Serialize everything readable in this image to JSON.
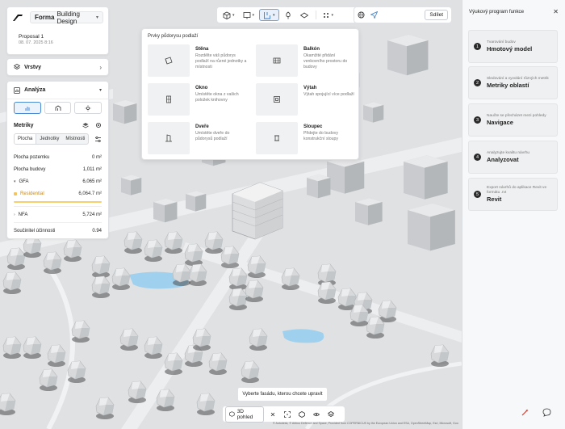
{
  "brand": {
    "name_bold": "Forma",
    "name_rest": "Building Design"
  },
  "proposal": {
    "name": "Proposal 1",
    "date": "08. 07. 2025 8:16"
  },
  "layers": {
    "label": "Vrstvy"
  },
  "analysis": {
    "label": "Analýza",
    "metrics_label": "Metriky",
    "tabs": [
      "Plocha",
      "Jednotky",
      "Místnosti"
    ],
    "rows": {
      "plot_area": {
        "label": "Plocha pozemku",
        "value": "0 m²"
      },
      "building_area": {
        "label": "Plocha budovy",
        "value": "1,011 m²"
      },
      "gfa": {
        "label": "GFA",
        "value": "6,065 m²"
      },
      "residential": {
        "label": "Residential",
        "value": "6,064.7 m²"
      },
      "nfa": {
        "label": "NFA",
        "value": "5,724 m²"
      },
      "efficiency": {
        "label": "Součinitel účinnosti",
        "value": "0.94"
      }
    }
  },
  "colors": {
    "accent": "#4a8bd4",
    "residential": "#f3c45b"
  },
  "toolbar": {
    "share_label": "Sdílet"
  },
  "panel": {
    "title": "Prvky půdorysu podlaží",
    "items": [
      {
        "title": "Stěna",
        "desc": "Rozdělte váš půdorys podlaží na různé jednotky a místnosti",
        "icon": "wall-icon"
      },
      {
        "title": "Balkón",
        "desc": "Okamžité přidání venkovního prostoru do budovy",
        "icon": "balcony-icon"
      },
      {
        "title": "Okno",
        "desc": "Umístěte okna z vašich položek knihovny",
        "icon": "window-icon"
      },
      {
        "title": "Výtah",
        "desc": "Výtah spojující více podlaží",
        "icon": "elevator-icon"
      },
      {
        "title": "Dveře",
        "desc": "Umístěte dveře do půdorysů podlaží",
        "icon": "door-icon"
      },
      {
        "title": "Sloupec",
        "desc": "Přidejte do budovy konstrukční sloupy",
        "icon": "column-icon"
      }
    ]
  },
  "tooltip": "Vyberte fasádu, kterou chcete upravit",
  "bottom": {
    "view_label": "3D pohled"
  },
  "attribution": "© Autodesk, © Airbus Defence and Space, Provided from COPERNICUS by the European Union and ESA, OpenStreetMap, Esri, Microsoft, Google, USGS, SDS Es…",
  "right_panel": {
    "title": "Výukový program funkce",
    "steps": [
      {
        "num": "1",
        "sub": "Tvarování budov",
        "main": "Hmotový model"
      },
      {
        "num": "2",
        "sub": "Sledování a vyvolání různých metrik",
        "main": "Metriky oblastí"
      },
      {
        "num": "3",
        "sub": "Naučte se přecházet mezi pohledy",
        "main": "Navigace"
      },
      {
        "num": "4",
        "sub": "Analyzujte kvalitu návrhu",
        "main": "Analyzovat"
      },
      {
        "num": "5",
        "sub": "Export návrhů do aplikace Revit ve formátu .rvt",
        "main": "Revit"
      }
    ]
  }
}
